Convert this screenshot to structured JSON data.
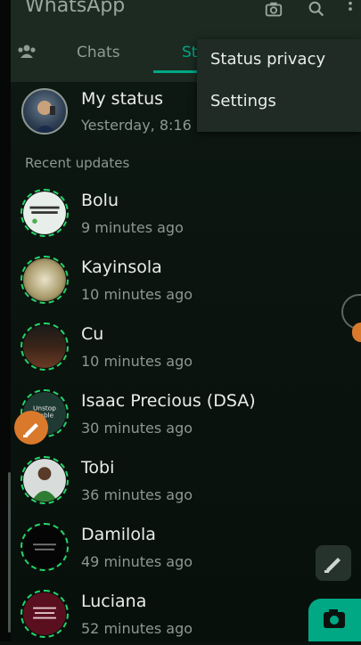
{
  "app_title": "WhatsApp",
  "tabs": [
    "Chats",
    "St"
  ],
  "my_status": {
    "name": "My status",
    "time": "Yesterday, 8:16"
  },
  "section_label": "Recent updates",
  "contacts": [
    {
      "name": "Bolu",
      "time": "9 minutes ago"
    },
    {
      "name": "Kayinsola",
      "time": "10 minutes ago"
    },
    {
      "name": "Cu",
      "time": "10 minutes ago"
    },
    {
      "name": "Isaac Precious (DSA)",
      "time": "30 minutes ago"
    },
    {
      "name": "Tobi",
      "time": "36 minutes ago"
    },
    {
      "name": "Damilola",
      "time": "49 minutes ago"
    },
    {
      "name": "Luciana",
      "time": "52 minutes ago"
    }
  ],
  "menu": {
    "items": [
      "Status privacy",
      "Settings"
    ]
  },
  "colors": {
    "accent": "#00a884",
    "ring": "#25d366",
    "orange": "#d9792c"
  },
  "icons": {
    "camera": "camera-icon",
    "search": "search-icon",
    "more": "more-vert-icon",
    "people": "communities-icon",
    "pencil": "pencil-icon"
  }
}
